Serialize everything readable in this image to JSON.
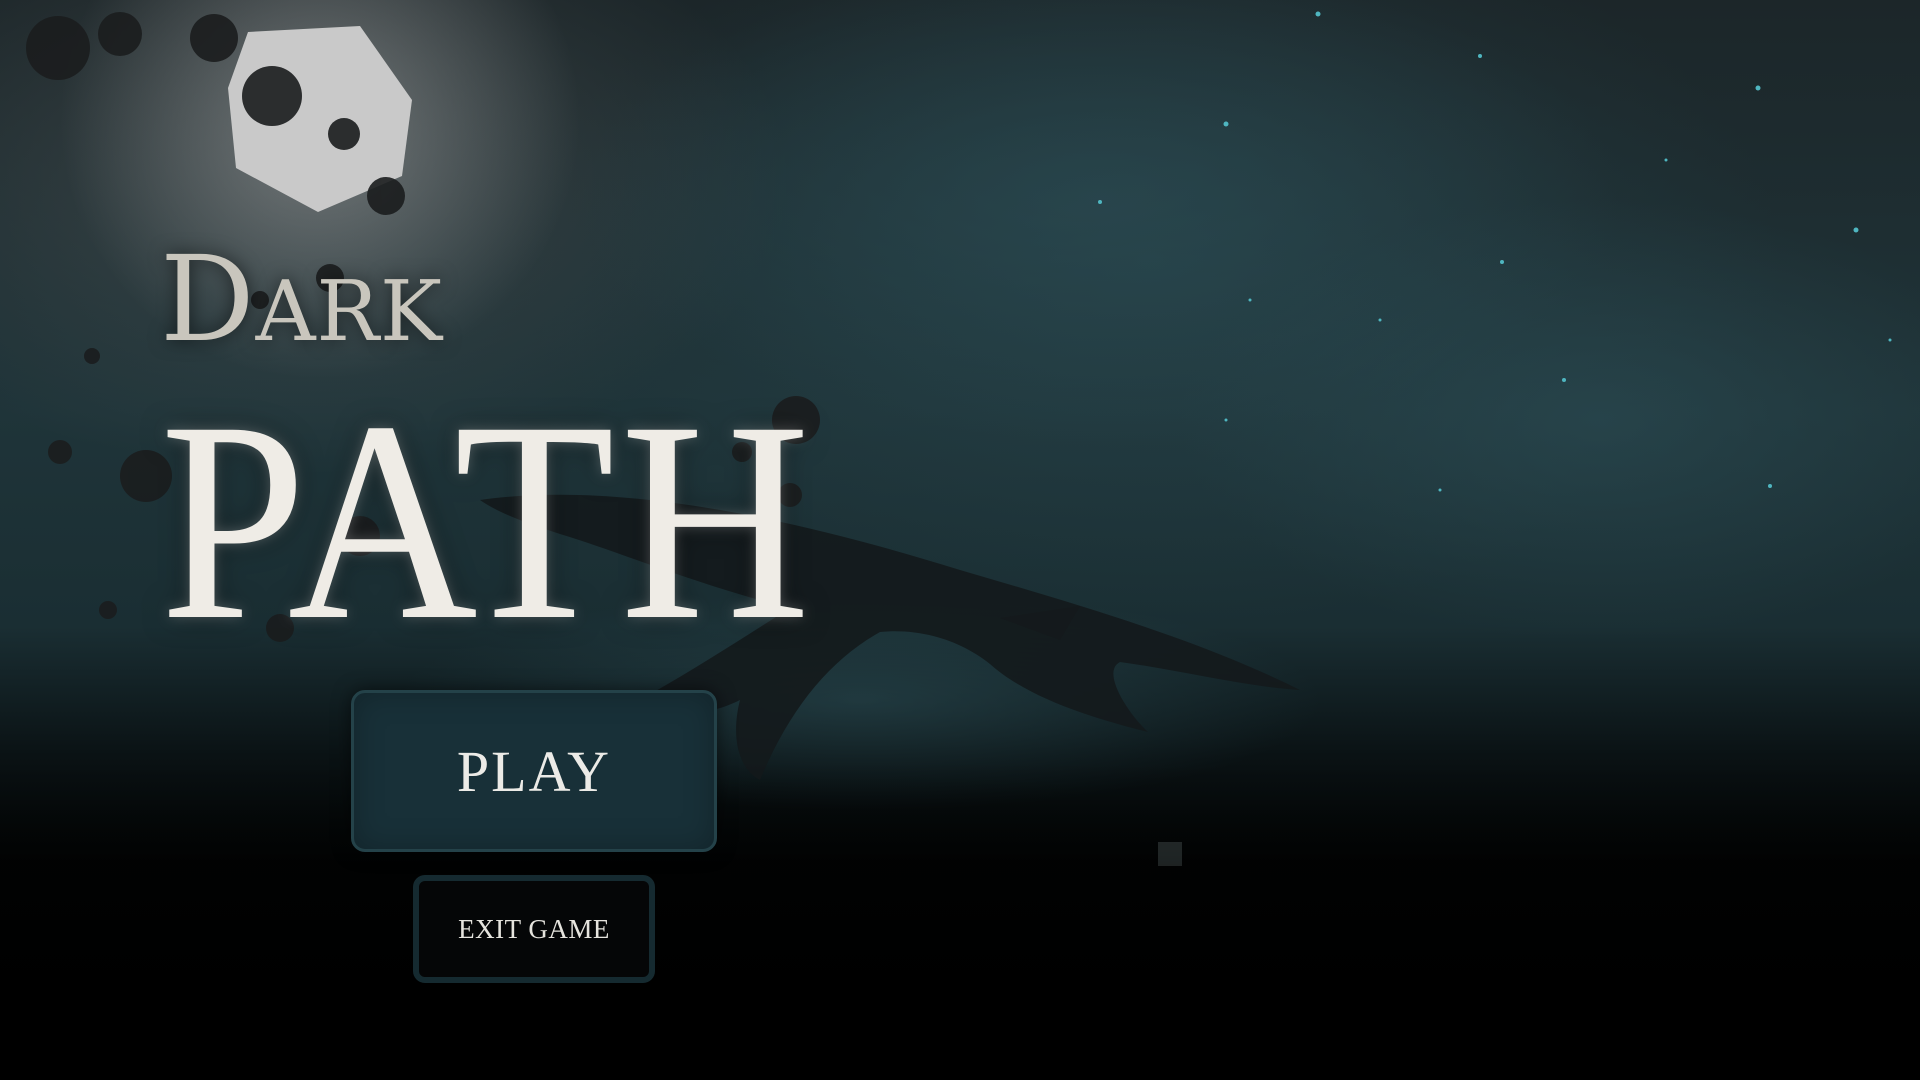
{
  "game": {
    "title_line1": "Dark",
    "title_line2": "PATH"
  },
  "menu": {
    "play_label": "PLAY",
    "exit_label": "EXIT GAME"
  },
  "colors": {
    "background_teal": "#1f3439",
    "play_button_fill": "#183038",
    "exit_button_border": "#152a30",
    "title_text": "#efece6"
  }
}
